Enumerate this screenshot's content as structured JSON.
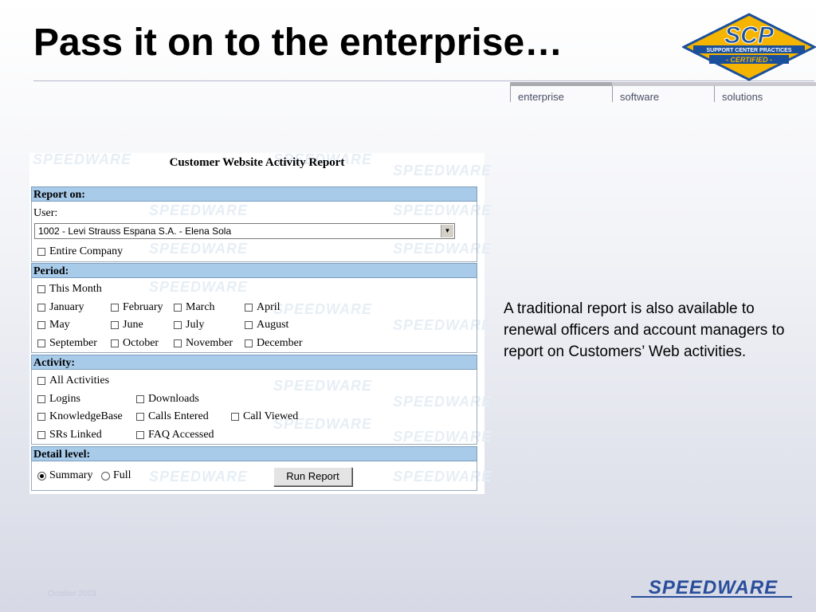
{
  "slide": {
    "title": "Pass it on to the enterprise…",
    "nav_tabs": [
      "enterprise",
      "software",
      "solutions"
    ],
    "description": "A traditional report is also available to renewal officers and account managers to report on Customers’ Web activities.",
    "footer_date": "October 2003"
  },
  "logos": {
    "scp_main": "SCP",
    "scp_band": "SUPPORT CENTER PRACTICES",
    "scp_certified": "- CERTIFIED -",
    "speedware": "SPEEDWARE",
    "watermark": "SPEEDWARE"
  },
  "report": {
    "title": "Customer Website Activity Report",
    "report_on": {
      "heading": "Report on:",
      "user_label": "User:",
      "user_selected": "1002 - Levi Strauss Espana S.A. - Elena Sola",
      "entire_company": "Entire Company"
    },
    "period": {
      "heading": "Period:",
      "this_month": "This Month",
      "months": [
        "January",
        "February",
        "March",
        "April",
        "May",
        "June",
        "July",
        "August",
        "September",
        "October",
        "November",
        "December"
      ]
    },
    "activity": {
      "heading": "Activity:",
      "all": "All Activities",
      "items": [
        "Logins",
        "Downloads",
        "KnowledgeBase",
        "Calls Entered",
        "Call Viewed",
        "SRs Linked",
        "FAQ Accessed"
      ]
    },
    "detail": {
      "heading": "Detail level:",
      "summary": "Summary",
      "full": "Full",
      "selected": "Summary",
      "run_button": "Run Report"
    }
  },
  "colors": {
    "section_header": "#a8cbea",
    "scp_gold": "#f5b400",
    "scp_blue": "#1a4f9c",
    "speedware_blue": "#2a4e9b"
  }
}
